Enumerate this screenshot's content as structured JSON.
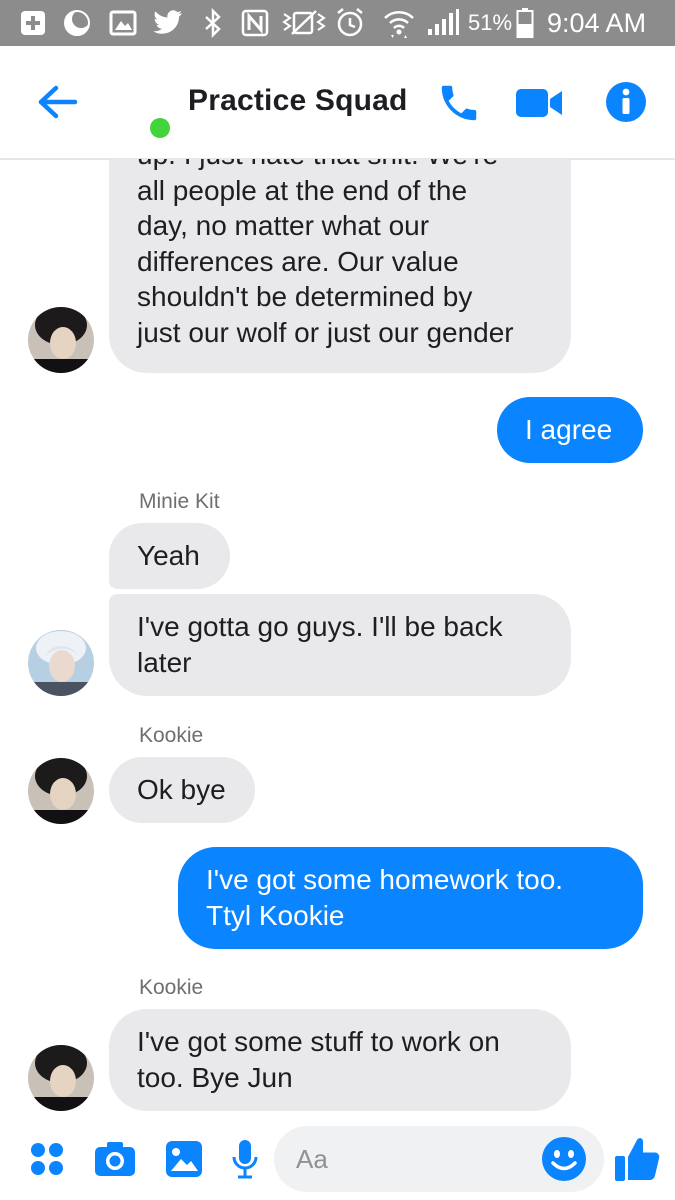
{
  "status_bar": {
    "battery_percent": "51%",
    "time": "9:04 AM",
    "icons": [
      "plus-box-icon",
      "moon-icon",
      "image-icon",
      "twitter-icon",
      "bluetooth-icon",
      "nfc-icon",
      "mute-icon",
      "alarm-icon",
      "wifi-icon",
      "signal-icon",
      "battery-icon"
    ]
  },
  "header": {
    "title": "Practice Squad",
    "status": "online",
    "icons": [
      "back-arrow-icon",
      "phone-icon",
      "video-camera-icon",
      "info-icon"
    ]
  },
  "messages": [
    {
      "direction": "incoming",
      "lines": [
        "up. I just hate that shit. We're",
        "all people at the end of the",
        "day, no matter what our",
        "differences are. Our value",
        "shouldn't be determined by",
        "just our wolf or just our gender"
      ]
    },
    {
      "direction": "outgoing",
      "lines": [
        "I agree"
      ]
    },
    {
      "direction": "incoming",
      "sender": "Minie Kit",
      "lines": [
        "Yeah"
      ]
    },
    {
      "direction": "incoming",
      "lines": [
        "I've gotta go guys. I'll be back",
        "later"
      ]
    },
    {
      "direction": "incoming",
      "sender": "Kookie",
      "lines": [
        "Ok bye"
      ]
    },
    {
      "direction": "outgoing",
      "lines": [
        "I've got some homework too.",
        "Ttyl Kookie"
      ]
    },
    {
      "direction": "incoming",
      "sender": "Kookie",
      "lines": [
        "I've got some stuff to work on",
        "too. Bye Jun"
      ]
    }
  ],
  "composer": {
    "placeholder": "Aa",
    "icons": [
      "apps-grid-icon",
      "camera-icon",
      "gallery-icon",
      "microphone-icon",
      "emoji-icon",
      "thumbs-up-icon"
    ]
  },
  "colors": {
    "accent": "#0a84ff",
    "status_bar_bg": "#8c8c8c",
    "incoming_bubble": "#e9e9eb",
    "online": "#42d43a"
  }
}
